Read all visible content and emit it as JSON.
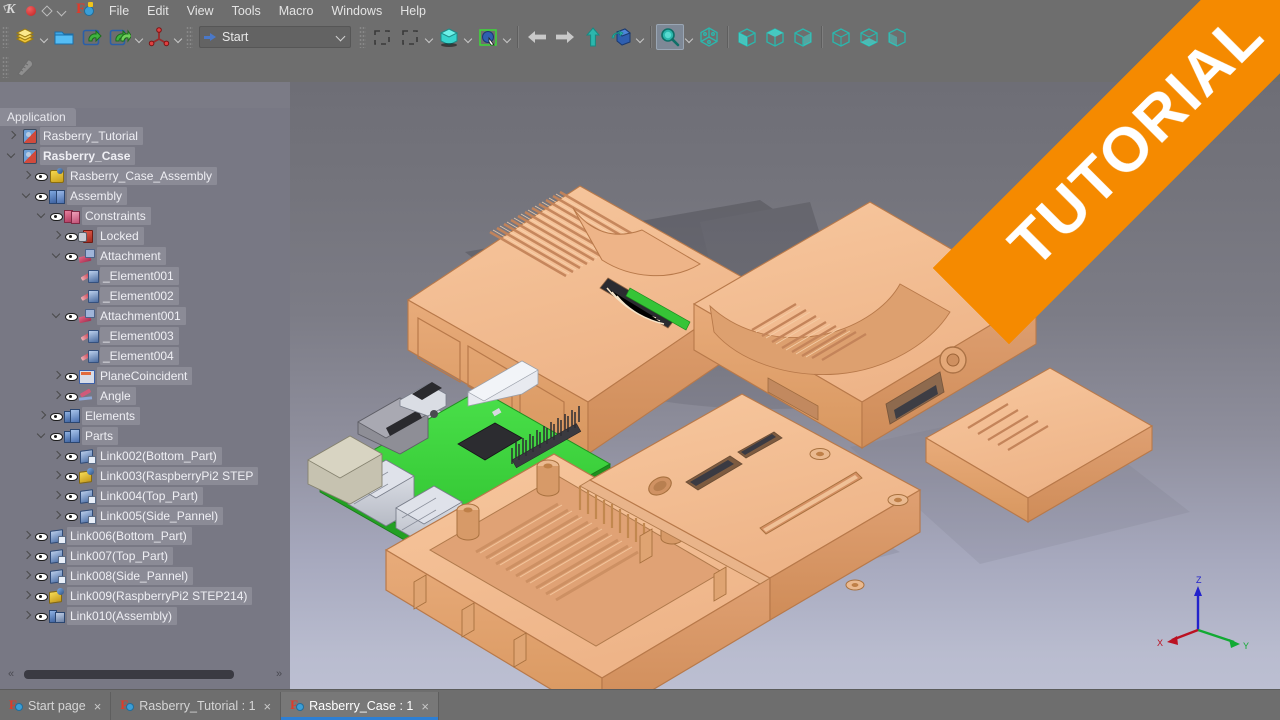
{
  "window": {
    "system_icons": [
      "kde-logo",
      "record-dot",
      "diamond",
      "chevron-down"
    ],
    "app_icon": "freecad-logo"
  },
  "menubar": {
    "items": [
      {
        "label": "File"
      },
      {
        "label": "Edit"
      },
      {
        "label": "View"
      },
      {
        "label": "Tools"
      },
      {
        "label": "Macro"
      },
      {
        "label": "Windows"
      },
      {
        "label": "Help"
      }
    ]
  },
  "toolbar": {
    "workbench": {
      "value": "Start",
      "icon": "blue-arrow-icon",
      "caret": "chevron-down-icon"
    },
    "file_group": [
      {
        "name": "new-document-icon",
        "icon": "yellow-stack"
      },
      {
        "name": "open-document-icon",
        "icon": "blue-folder"
      },
      {
        "name": "save-document-icon",
        "icon": "save-arrow"
      },
      {
        "name": "save-all-icon",
        "icon": "save-arrows"
      },
      {
        "name": "refresh-icon",
        "icon": "red-axis"
      }
    ],
    "selection_group": [
      {
        "name": "bounding-box-icon"
      },
      {
        "name": "select-all-icon"
      },
      {
        "name": "draw-style-icon"
      },
      {
        "name": "appearance-icon"
      }
    ],
    "nav_group": [
      {
        "name": "back-arrow-icon"
      },
      {
        "name": "forward-arrow-icon"
      },
      {
        "name": "up-arrow-icon"
      },
      {
        "name": "rotate-view-icon"
      }
    ],
    "view_group": [
      {
        "name": "fit-all-icon",
        "active": true
      },
      {
        "name": "isometric-view-icon"
      },
      {
        "name": "front-view-icon"
      },
      {
        "name": "top-view-icon"
      },
      {
        "name": "right-view-icon"
      },
      {
        "name": "rear-view-icon"
      },
      {
        "name": "bottom-view-icon"
      },
      {
        "name": "left-view-icon"
      }
    ],
    "second_row": [
      {
        "name": "measure-icon",
        "disabled": true
      }
    ]
  },
  "tree": {
    "header": "Application",
    "scrollbar": {
      "left_arrow": "«",
      "right_arrow": "»"
    },
    "items": [
      {
        "label": "Rasberry_Tutorial",
        "indent": 0,
        "icon": "document-icon",
        "expander": "closed",
        "eye": false,
        "bold": false
      },
      {
        "label": "Rasberry_Case",
        "indent": 0,
        "icon": "document-icon",
        "expander": "open",
        "eye": false,
        "bold": true
      },
      {
        "label": "Rasberry_Case_Assembly",
        "indent": 1,
        "icon": "yellow-part-icon",
        "expander": "closed",
        "eye": true,
        "bold": false
      },
      {
        "label": "Assembly",
        "indent": 1,
        "icon": "assembly-icon",
        "expander": "open",
        "eye": true,
        "bold": false
      },
      {
        "label": "Constraints",
        "indent": 2,
        "icon": "constraints-icon",
        "expander": "open",
        "eye": true,
        "bold": false
      },
      {
        "label": "Locked",
        "indent": 3,
        "icon": "lock-icon",
        "expander": "closed",
        "eye": true,
        "bold": false
      },
      {
        "label": "Attachment",
        "indent": 3,
        "icon": "attachment-icon",
        "expander": "open",
        "eye": true,
        "bold": false
      },
      {
        "label": "_Element001",
        "indent": 4,
        "icon": "element-icon",
        "expander": "none",
        "eye": false,
        "bold": false
      },
      {
        "label": "_Element002",
        "indent": 4,
        "icon": "element-icon",
        "expander": "none",
        "eye": false,
        "bold": false
      },
      {
        "label": "Attachment001",
        "indent": 3,
        "icon": "attachment-icon",
        "expander": "open",
        "eye": true,
        "bold": false
      },
      {
        "label": "_Element003",
        "indent": 4,
        "icon": "element-icon",
        "expander": "none",
        "eye": false,
        "bold": false
      },
      {
        "label": "_Element004",
        "indent": 4,
        "icon": "element-icon",
        "expander": "none",
        "eye": false,
        "bold": false
      },
      {
        "label": "PlaneCoincident",
        "indent": 3,
        "icon": "plane-icon",
        "expander": "closed",
        "eye": true,
        "bold": false
      },
      {
        "label": "Angle",
        "indent": 3,
        "icon": "angle-icon",
        "expander": "closed",
        "eye": true,
        "bold": false
      },
      {
        "label": "Elements",
        "indent": 2,
        "icon": "elements-icon",
        "expander": "closed",
        "eye": true,
        "bold": false
      },
      {
        "label": "Parts",
        "indent": 2,
        "icon": "elements-icon",
        "expander": "open",
        "eye": true,
        "bold": false
      },
      {
        "label": "Link002(Bottom_Part)",
        "indent": 3,
        "icon": "link-icon",
        "expander": "closed",
        "eye": true,
        "bold": false
      },
      {
        "label": "Link003(RaspberryPi2 STEP",
        "indent": 3,
        "icon": "link-yellow-icon",
        "expander": "closed",
        "eye": true,
        "bold": false
      },
      {
        "label": "Link004(Top_Part)",
        "indent": 3,
        "icon": "link-icon",
        "expander": "closed",
        "eye": true,
        "bold": false
      },
      {
        "label": "Link005(Side_Pannel)",
        "indent": 3,
        "icon": "link-icon",
        "expander": "closed",
        "eye": true,
        "bold": false
      },
      {
        "label": "Link006(Bottom_Part)",
        "indent": 1,
        "icon": "link-icon",
        "expander": "closed",
        "eye": true,
        "bold": false
      },
      {
        "label": "Link007(Top_Part)",
        "indent": 1,
        "icon": "link-icon",
        "expander": "closed",
        "eye": true,
        "bold": false
      },
      {
        "label": "Link008(Side_Pannel)",
        "indent": 1,
        "icon": "link-icon",
        "expander": "closed",
        "eye": true,
        "bold": false
      },
      {
        "label": "Link009(RaspberryPi2 STEP214)",
        "indent": 1,
        "icon": "link-yellow-icon",
        "expander": "closed",
        "eye": true,
        "bold": false
      },
      {
        "label": "Link010(Assembly)",
        "indent": 1,
        "icon": "link-assembly-icon",
        "expander": "closed",
        "eye": true,
        "bold": false
      }
    ]
  },
  "viewport": {
    "nav_axes": [
      {
        "label": "Z",
        "color": "#2222cc"
      },
      {
        "label": "Y",
        "color": "#11aa33"
      },
      {
        "label": "X",
        "color": "#bb1122"
      }
    ],
    "model_description": "Exploded Raspberry Pi case assembly: top cover, side panel, bottom tray and green PCB",
    "colors": {
      "case_top": "#f3bd93",
      "case_side": "#e3a271",
      "case_dark": "#c8845a",
      "pcb_green": "#3ad23a",
      "connector_silver": "#c9ccd4",
      "background_top": "#6e6e76",
      "background_bottom": "#bcbfd2"
    }
  },
  "ribbon": {
    "label": "TUTORIAL",
    "color": "#f58a00"
  },
  "tabbar": {
    "tabs": [
      {
        "label": "Start page",
        "active": false,
        "close": "×"
      },
      {
        "label": "Rasberry_Tutorial : 1",
        "active": false,
        "close": "×"
      },
      {
        "label": "Rasberry_Case : 1",
        "active": true,
        "close": "×"
      }
    ]
  }
}
